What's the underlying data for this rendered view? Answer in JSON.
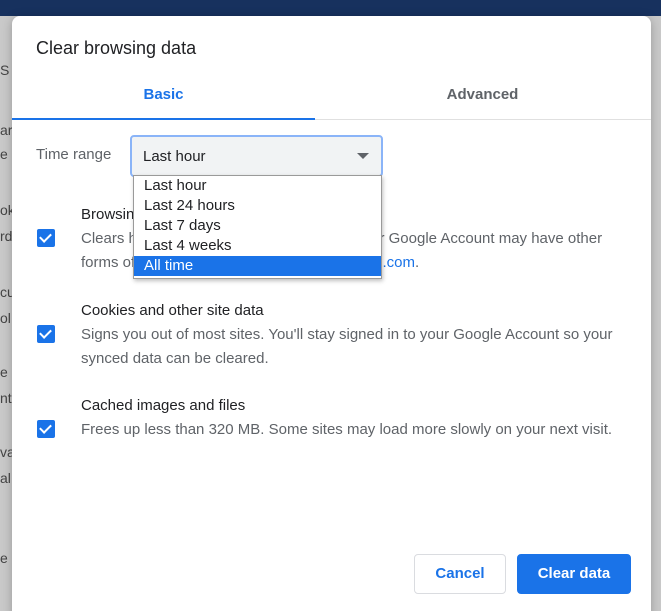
{
  "background": {
    "fragments": [
      "S",
      "ar",
      "e",
      "ok",
      "rd",
      "cu",
      "ol",
      "e S",
      "nt",
      "va",
      "al",
      "e"
    ]
  },
  "dialog": {
    "title": "Clear browsing data",
    "tabs": [
      {
        "label": "Basic",
        "active": true
      },
      {
        "label": "Advanced",
        "active": false
      }
    ],
    "time_range": {
      "label": "Time range",
      "value": "Last hour",
      "options": [
        "Last hour",
        "Last 24 hours",
        "Last 7 days",
        "Last 4 weeks",
        "All time"
      ],
      "highlighted": "All time"
    },
    "items": [
      {
        "title": "Browsing history",
        "desc_prefix": "Clears history from all signed-in devices. Your Google Account may have other forms of browsing history at ",
        "desc_link": "myactivity.google.com",
        "desc_suffix": ".",
        "checked": true
      },
      {
        "title": "Cookies and other site data",
        "desc": "Signs you out of most sites. You'll stay signed in to your Google Account so your synced data can be cleared.",
        "checked": true
      },
      {
        "title": "Cached images and files",
        "desc": "Frees up less than 320 MB. Some sites may load more slowly on your next visit.",
        "checked": true
      }
    ],
    "buttons": {
      "cancel": "Cancel",
      "clear": "Clear data"
    }
  },
  "colors": {
    "accent": "#1a73e8",
    "text": "#202124",
    "secondary_text": "#5f6368"
  }
}
